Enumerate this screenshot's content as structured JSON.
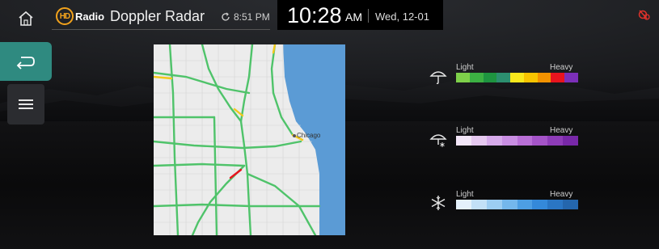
{
  "header": {
    "logo_hd": "HD",
    "logo_radio": "Radio",
    "title": "Doppler Radar",
    "updated_time": "8:51 PM",
    "icons": [
      "hd-radio-logo-icon",
      "refresh-icon",
      "connection-off-icon"
    ]
  },
  "clock": {
    "time": "10:28",
    "ampm": "AM",
    "date": "Wed, 12-01"
  },
  "rail": {
    "icons": [
      "home-icon",
      "back-icon",
      "menu-icon"
    ],
    "back_color": "#2f8a80"
  },
  "map": {
    "city_label": "Chicago",
    "water_color": "#5b9bd5",
    "land_color": "#ececec",
    "road_color": "#4fc36a"
  },
  "legend": {
    "rain": {
      "icon": "umbrella-icon",
      "light": "Light",
      "heavy": "Heavy",
      "colors": [
        "#7ed04a",
        "#3cb043",
        "#1e9440",
        "#2c8f6f",
        "#f8e81c",
        "#f7c400",
        "#f29200",
        "#e8141e",
        "#7b2fb8"
      ]
    },
    "mix": {
      "icon": "umbrella-snow-icon",
      "light": "Light",
      "heavy": "Heavy",
      "colors": [
        "#f3e6f8",
        "#e6c9f0",
        "#d6aaea",
        "#c98ee2",
        "#b96fd6",
        "#a554c8",
        "#8e3cb8",
        "#7828a8"
      ]
    },
    "snow": {
      "icon": "snowflake-icon",
      "light": "Light",
      "heavy": "Heavy",
      "colors": [
        "#e4f1fb",
        "#c2e0f7",
        "#9ccdf2",
        "#74b7ec",
        "#4d9ee3",
        "#3489da",
        "#2a76c4",
        "#2466ad"
      ]
    }
  }
}
